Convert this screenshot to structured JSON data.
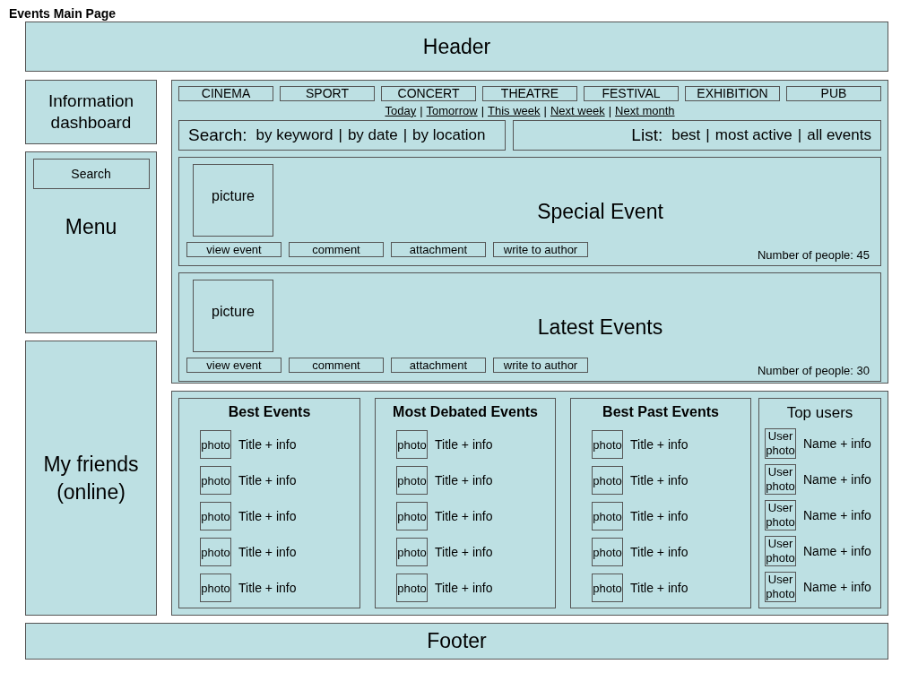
{
  "page_title": "Events Main Page",
  "header": "Header",
  "sidebar": {
    "dashboard": "Information dashboard",
    "search_button": "Search",
    "menu": "Menu",
    "friends": "My friends (online)"
  },
  "categories": [
    {
      "label": "CINEMA"
    },
    {
      "label": "SPORT"
    },
    {
      "label": "CONCERT"
    },
    {
      "label": "THEATRE"
    },
    {
      "label": "FESTIVAL"
    },
    {
      "label": "EXHIBITION"
    },
    {
      "label": "PUB"
    }
  ],
  "periods": {
    "separator": "|",
    "links": [
      "Today",
      "Tomorrow",
      "This week",
      "Next week",
      "Next month"
    ]
  },
  "search": {
    "label": "Search:",
    "separator": "|",
    "options": [
      "by keyword",
      "by date",
      "by location"
    ]
  },
  "list": {
    "label": "List:",
    "separator": "|",
    "options": [
      "best",
      "most active",
      "all events"
    ]
  },
  "events": [
    {
      "picture": "picture",
      "title": "Special Event",
      "actions": [
        "view event",
        "comment",
        "attachment",
        "write to author"
      ],
      "people": "Number of people: 45"
    },
    {
      "picture": "picture",
      "title": "Latest Events",
      "actions": [
        "view event",
        "comment",
        "attachment",
        "write to author"
      ],
      "people": "Number of people: 30"
    }
  ],
  "columns": [
    {
      "title": "Best Events",
      "items": [
        {
          "photo": "photo",
          "text": "Title + info"
        },
        {
          "photo": "photo",
          "text": "Title + info"
        },
        {
          "photo": "photo",
          "text": "Title + info"
        },
        {
          "photo": "photo",
          "text": "Title + info"
        },
        {
          "photo": "photo",
          "text": "Title + info"
        }
      ]
    },
    {
      "title": "Most Debated Events",
      "items": [
        {
          "photo": "photo",
          "text": "Title + info"
        },
        {
          "photo": "photo",
          "text": "Title + info"
        },
        {
          "photo": "photo",
          "text": "Title + info"
        },
        {
          "photo": "photo",
          "text": "Title + info"
        },
        {
          "photo": "photo",
          "text": "Title + info"
        }
      ]
    },
    {
      "title": "Best Past Events",
      "items": [
        {
          "photo": "photo",
          "text": "Title + info"
        },
        {
          "photo": "photo",
          "text": "Title + info"
        },
        {
          "photo": "photo",
          "text": "Title + info"
        },
        {
          "photo": "photo",
          "text": "Title + info"
        },
        {
          "photo": "photo",
          "text": "Title + info"
        }
      ]
    }
  ],
  "top_users": {
    "title": "Top users",
    "items": [
      {
        "photo": "User photo",
        "text": "Name + info"
      },
      {
        "photo": "User photo",
        "text": "Name + info"
      },
      {
        "photo": "User photo",
        "text": "Name + info"
      },
      {
        "photo": "User photo",
        "text": "Name + info"
      },
      {
        "photo": "User photo",
        "text": "Name + info"
      }
    ]
  },
  "footer": "Footer"
}
